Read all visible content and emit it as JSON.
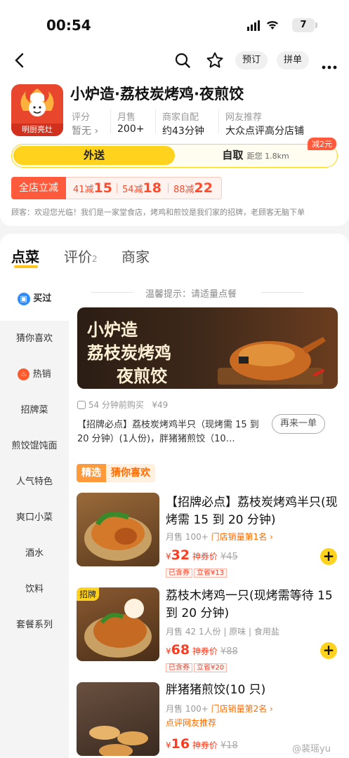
{
  "status_bar": {
    "time": "00:54",
    "battery": "7"
  },
  "nav": {
    "book_label": "预订",
    "group_order_label": "拼单"
  },
  "store": {
    "logo_text": "明厨亮灶",
    "name": "小炉造·荔枝炭烤鸡·夜煎饺",
    "stats": [
      {
        "label": "评分",
        "value": "暂无"
      },
      {
        "label": "月售",
        "value": "200+"
      },
      {
        "label": "商家自配",
        "value": "约43分钟"
      },
      {
        "label": "网友推荐",
        "value": "大众点评高分店铺"
      }
    ],
    "delivery_label": "外送",
    "pickup_label": "自取",
    "pickup_distance": "距您 1.8km",
    "pickup_badge": "减2元",
    "promo_main": "全店立减",
    "promos": [
      {
        "threshold": "41减",
        "amount": "15"
      },
      {
        "threshold": "54减",
        "amount": "18"
      },
      {
        "threshold": "88减",
        "amount": "22"
      }
    ],
    "notice": "顾客：欢迎您光临！我们是一家堂食店，烤鸡和煎饺是我们家的招牌，老顾客无脑下单"
  },
  "tabs": [
    {
      "label": "点菜",
      "count": ""
    },
    {
      "label": "评价",
      "count": "2"
    },
    {
      "label": "商家",
      "count": ""
    }
  ],
  "sidebar": [
    {
      "label": "买过",
      "icon": "bag-icon"
    },
    {
      "label": "猜你喜欢"
    },
    {
      "label": "热销",
      "icon": "fire-icon"
    },
    {
      "label": "招牌菜"
    },
    {
      "label": "煎饺馄饨面"
    },
    {
      "label": "人气特色"
    },
    {
      "label": "爽口小菜"
    },
    {
      "label": "酒水"
    },
    {
      "label": "饮料"
    },
    {
      "label": "套餐系列"
    }
  ],
  "tip": "温馨提示：请适量点餐",
  "banner": {
    "line1": "小炉造",
    "line2": "荔枝炭烤鸡",
    "line3": "夜煎饺"
  },
  "last_order": {
    "time": "54 分钟前购买",
    "price": "¥49",
    "desc": "【招牌必点】荔枝炭烤鸡半只（现烤需 15 到 20 分钟）(1人份)，胖猪猪煎饺（10…",
    "again_label": "再来一单"
  },
  "section": {
    "tag1": "精选",
    "tag2": "猜你喜欢"
  },
  "products": [
    {
      "name": "【招牌必点】荔枝炭烤鸡半只(现烤需 15 到 20 分钟)",
      "sales": "月售 100+",
      "rank": "门店销量第1名 ›",
      "price": "32",
      "price_tag": "神券价",
      "orig": "¥45",
      "coupon1": "已含券",
      "coupon2": "立省¥13"
    },
    {
      "name": "荔枝木烤鸡一只(现烤需等待 15 到 20 分钟)",
      "badge": "招牌",
      "sales": "月售 42  1人份 | 原味 | 食用盐",
      "price": "68",
      "price_tag": "神券价",
      "orig": "¥88",
      "coupon1": "已含券",
      "coupon2": "立省¥20"
    },
    {
      "name": "胖猪猪煎饺(10 只)",
      "sales": "月售 100+",
      "rank": "门店销量第2名 ›",
      "note": "点评网友推荐",
      "price": "16",
      "price_tag": "神券价",
      "orig": "¥18"
    }
  ],
  "watermark": "@裴瑶yu",
  "colors": {
    "accent": "#ffd21e",
    "price": "#ff3b1f",
    "promo": "#ff5a3c"
  }
}
